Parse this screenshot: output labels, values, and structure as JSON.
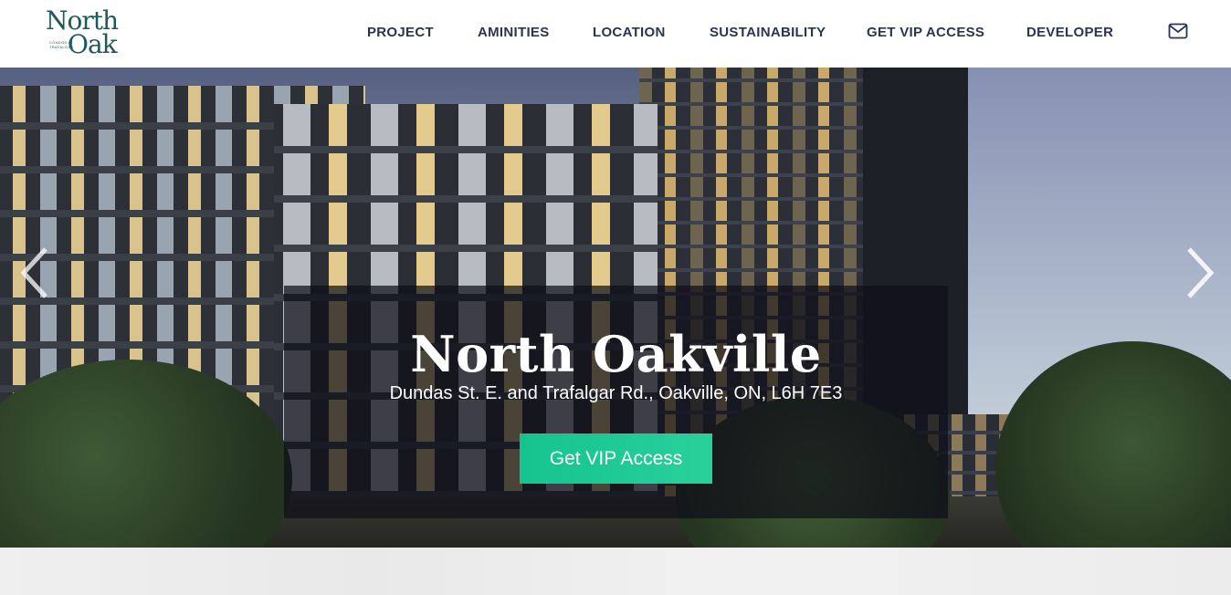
{
  "brand": {
    "line1": "North",
    "line2": "Oak",
    "tagline": "CONDOS AT TRAFALGAR"
  },
  "nav": {
    "items": [
      {
        "label": "PROJECT"
      },
      {
        "label": "AMINITIES"
      },
      {
        "label": "LOCATION"
      },
      {
        "label": "SUSTAINABILITY"
      },
      {
        "label": "GET VIP ACCESS"
      },
      {
        "label": "DEVELOPER"
      }
    ],
    "contact_icon": "mail-icon"
  },
  "hero": {
    "title": "North Oakville",
    "address": "Dundas St. E. and Trafalgar Rd., Oakville, ON, L6H 7E3",
    "cta_label": "Get VIP Access",
    "prev_icon": "chevron-left-icon",
    "next_icon": "chevron-right-icon"
  },
  "colors": {
    "brand_teal": "#1d5a5a",
    "nav_text": "#2b3550",
    "cta_green": "#1fca94",
    "overlay": "#0e0e18"
  }
}
